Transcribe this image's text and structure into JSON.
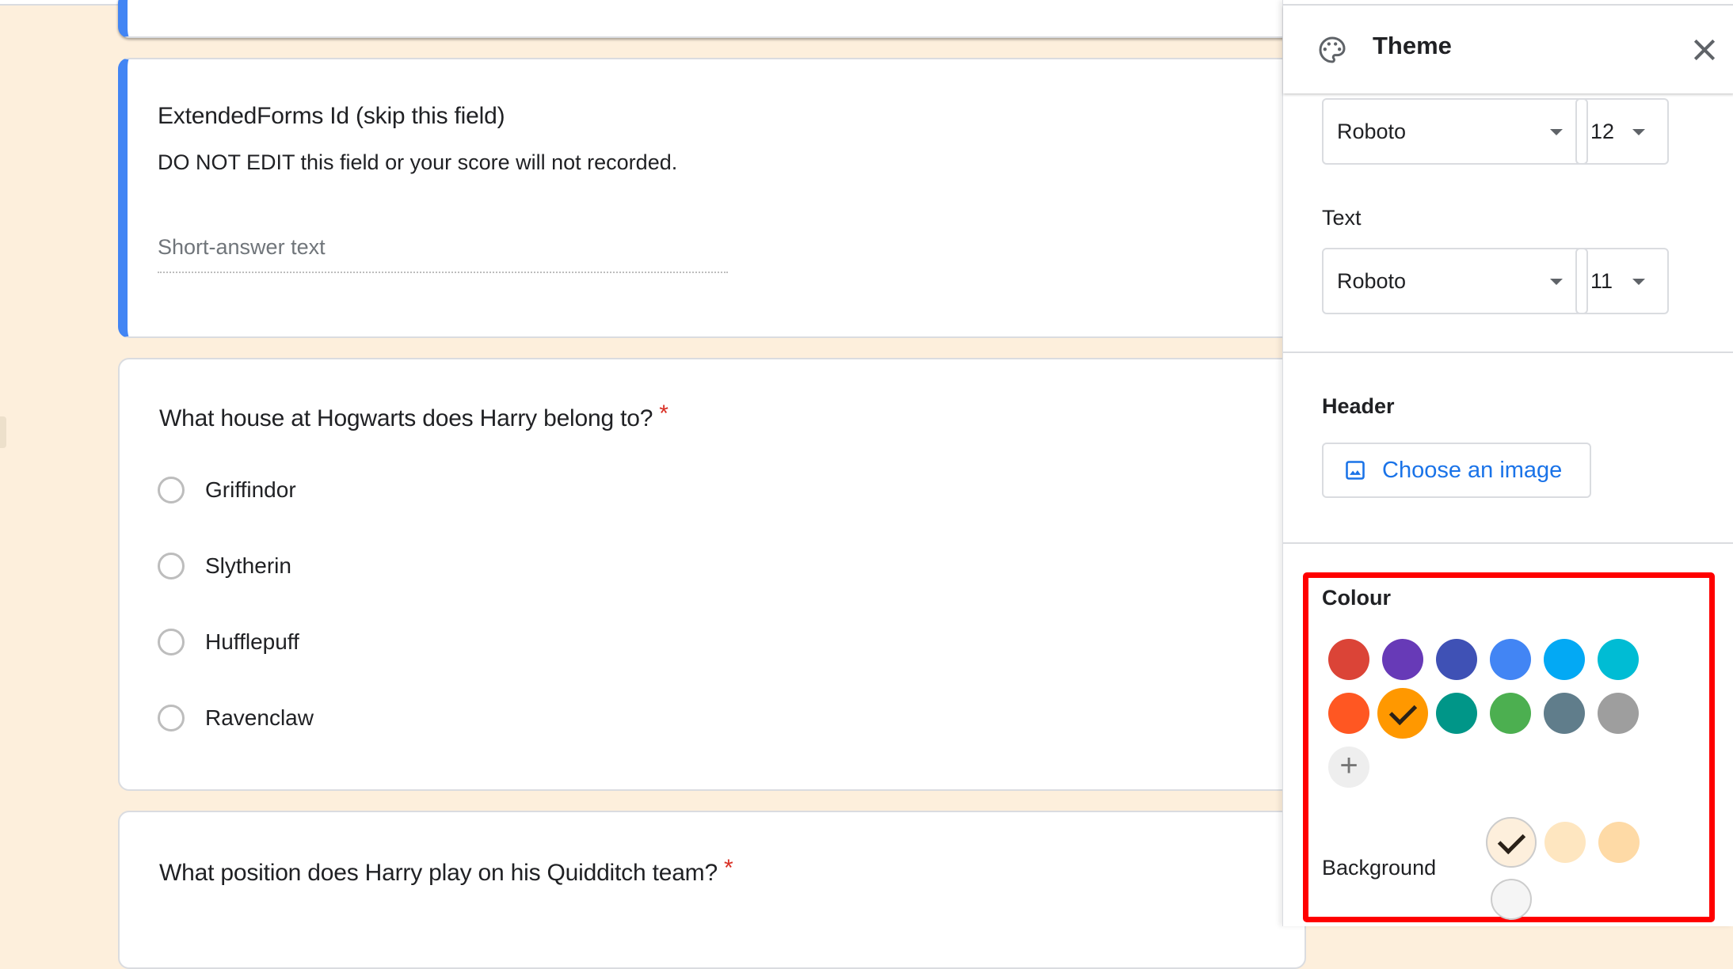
{
  "form": {
    "cards": [
      {
        "title": "ExtendedForms Id (skip this field)",
        "description": "DO NOT EDIT this field or your score will not recorded.",
        "input_placeholder": "Short-answer text"
      },
      {
        "title": "What house at Hogwarts does Harry belong to?",
        "required_mark": "*",
        "options": [
          "Griffindor",
          "Slytherin",
          "Hufflepuff",
          "Ravenclaw"
        ]
      },
      {
        "title": "What position does Harry play on his Quidditch team?",
        "required_mark": "*"
      }
    ]
  },
  "theme_panel": {
    "title": "Theme",
    "icon": "palette-icon",
    "close_icon": "close-icon",
    "header_font": {
      "family": "Roboto",
      "size": "12"
    },
    "text_section": {
      "label": "Text",
      "family": "Roboto",
      "size": "11"
    },
    "header_section": {
      "label": "Header",
      "button_label": "Choose an image",
      "button_icon": "image-icon"
    },
    "colour_section": {
      "label": "Colour",
      "colours": [
        "#db4437",
        "#673ab7",
        "#3f51b5",
        "#4285f4",
        "#03a9f4",
        "#00bcd4",
        "#ff5722",
        "#ff9800",
        "#009688",
        "#4caf50",
        "#607d8b",
        "#9e9e9e"
      ],
      "selected_colour": "#ff9800",
      "add_colour_icon": "plus-icon",
      "background_label": "Background",
      "backgrounds": [
        "#fdefdc",
        "#fee6c0",
        "#fedaa6",
        "#f5f5f5"
      ],
      "selected_background": "#fdefdc"
    },
    "highlight_color": "#ff0000",
    "accent_color": "#1a73e8"
  }
}
